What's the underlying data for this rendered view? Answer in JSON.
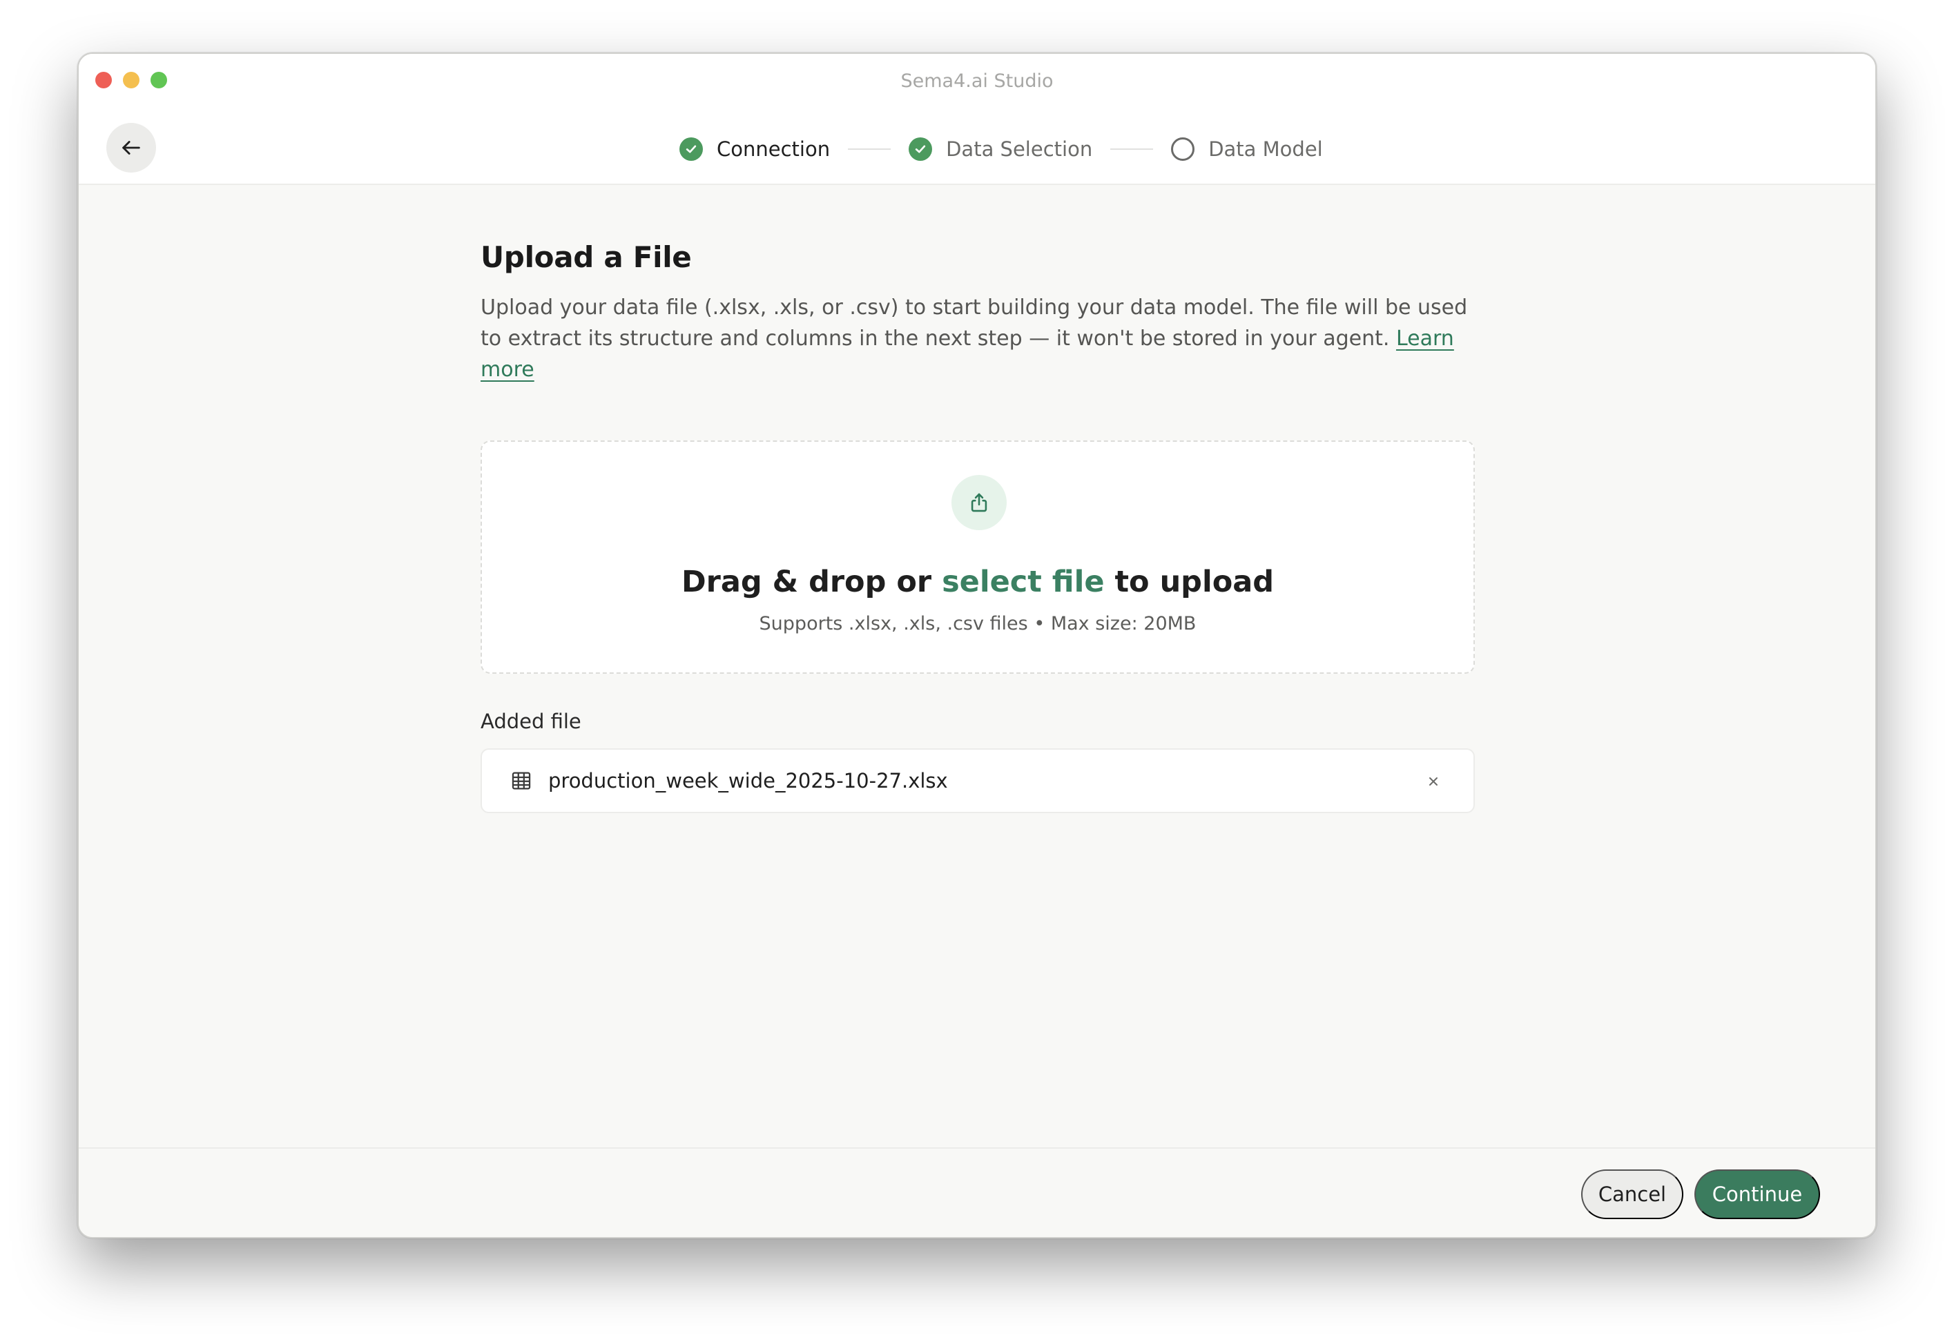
{
  "window": {
    "title": "Sema4.ai Studio"
  },
  "stepper": {
    "steps": [
      {
        "label": "Connection",
        "state": "done"
      },
      {
        "label": "Data Selection",
        "state": "done"
      },
      {
        "label": "Data Model",
        "state": "pending"
      }
    ]
  },
  "page": {
    "title": "Upload a File",
    "description": "Upload your data file (.xlsx, .xls, or .csv) to start building your data model. The file will be used to extract its structure and columns in the next step — it won't be stored in your agent.",
    "learn_more": "Learn more"
  },
  "dropzone": {
    "title_prefix": "Drag & drop or ",
    "title_link": "select file",
    "title_suffix": " to upload",
    "subtitle": "Supports .xlsx, .xls, .csv files • Max size: 20MB"
  },
  "added": {
    "label": "Added file",
    "file_name": "production_week_wide_2025-10-27.xlsx"
  },
  "footer": {
    "cancel_label": "Cancel",
    "continue_label": "Continue"
  },
  "colors": {
    "accent": "#3b7c5e",
    "check": "#4c9a5e",
    "link": "#2f7a5a"
  }
}
